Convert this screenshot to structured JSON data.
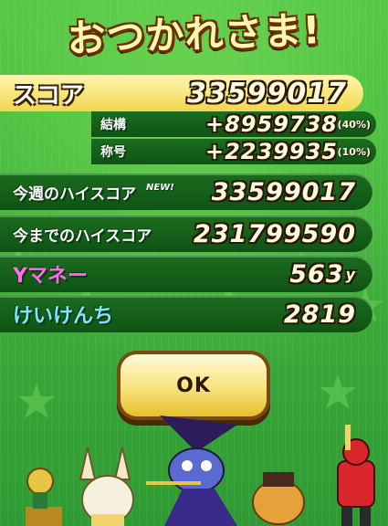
{
  "title": "おつかれさま!",
  "score": {
    "label": "スコア",
    "value": "33599017"
  },
  "bonuses": [
    {
      "label": "結構",
      "value": "+8959738",
      "pct": "(40%)"
    },
    {
      "label": "称号",
      "value": "+2239935",
      "pct": "(10%)"
    }
  ],
  "week_high": {
    "label": "今週のハイスコア",
    "new_badge": "NEW!",
    "value": "33599017"
  },
  "all_time_high": {
    "label": "今までのハイスコア",
    "value": "231799590"
  },
  "ymoney": {
    "label": "Yマネー",
    "value": "563",
    "unit": "y"
  },
  "exp": {
    "label": "けいけんち",
    "value": "2819"
  },
  "ok_button": "OK",
  "colors": {
    "panel_gold": "#f2d64d",
    "row_green": "#0f5314",
    "background": "#37a93a",
    "ok_button": "#f7e37a"
  }
}
